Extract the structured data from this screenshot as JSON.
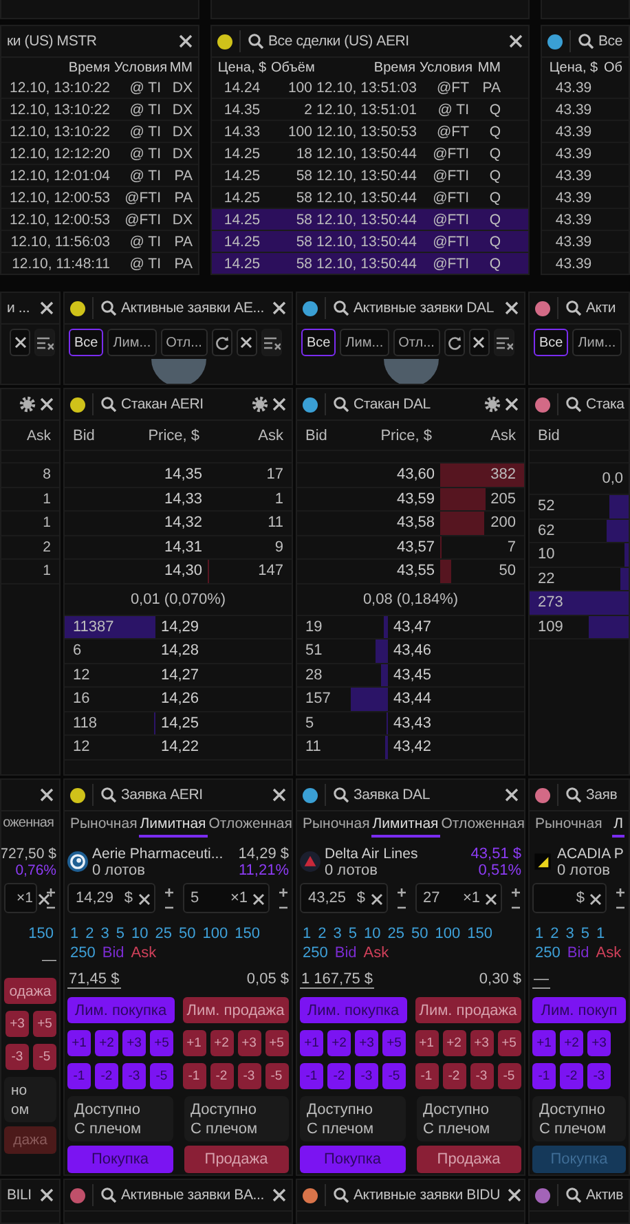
{
  "trades": [
    {
      "title": "ки (US) MSTR",
      "columns": [
        "Время",
        "Условия",
        "MM"
      ],
      "rows": [
        {
          "cells": [
            "12.10, 13:10:22",
            "@ TI",
            "DX"
          ],
          "selected": false
        },
        {
          "cells": [
            "12.10, 13:10:22",
            "@ TI",
            "DX"
          ],
          "selected": false
        },
        {
          "cells": [
            "12.10, 13:10:22",
            "@ TI",
            "DX"
          ],
          "selected": false
        },
        {
          "cells": [
            "12.10, 12:12:20",
            "@ TI",
            "DX"
          ],
          "selected": false
        },
        {
          "cells": [
            "12.10, 12:01:04",
            "@ TI",
            "PA"
          ],
          "selected": false
        },
        {
          "cells": [
            "12.10, 12:00:53",
            "@FTI",
            "PA"
          ],
          "selected": false
        },
        {
          "cells": [
            "12.10, 12:00:53",
            "@FTI",
            "DX"
          ],
          "selected": false
        },
        {
          "cells": [
            "12.10, 11:56:03",
            "@ TI",
            "PA"
          ],
          "selected": false
        },
        {
          "cells": [
            "12.10, 11:48:11",
            "@ TI",
            "PA"
          ],
          "selected": false
        }
      ]
    },
    {
      "color": "#cfc21a",
      "title": "Все сделки (US) AERI",
      "columns": [
        "Цена, $",
        "Объём",
        "Время",
        "Условия",
        "MM"
      ],
      "rows": [
        {
          "cells": [
            "14.24",
            "100",
            "12.10, 13:51:03",
            "@FT",
            "PA"
          ],
          "selected": false
        },
        {
          "cells": [
            "14.35",
            "2",
            "12.10, 13:51:01",
            "@ TI",
            "Q"
          ],
          "selected": false
        },
        {
          "cells": [
            "14.33",
            "100",
            "12.10, 13:50:53",
            "@FT",
            "Q"
          ],
          "selected": false
        },
        {
          "cells": [
            "14.25",
            "18",
            "12.10, 13:50:44",
            "@FTI",
            "Q"
          ],
          "selected": false
        },
        {
          "cells": [
            "14.25",
            "58",
            "12.10, 13:50:44",
            "@FTI",
            "Q"
          ],
          "selected": false
        },
        {
          "cells": [
            "14.25",
            "58",
            "12.10, 13:50:44",
            "@FTI",
            "Q"
          ],
          "selected": false
        },
        {
          "cells": [
            "14.25",
            "58",
            "12.10, 13:50:44",
            "@FTI",
            "Q"
          ],
          "selected": true
        },
        {
          "cells": [
            "14.25",
            "58",
            "12.10, 13:50:44",
            "@FTI",
            "Q"
          ],
          "selected": true
        },
        {
          "cells": [
            "14.25",
            "58",
            "12.10, 13:50:44",
            "@FTI",
            "Q"
          ],
          "selected": true
        }
      ]
    },
    {
      "color": "#3a9fd4",
      "title": "Все",
      "columns": [
        "Цена, $",
        "Об"
      ],
      "rows": [
        {
          "cells": [
            "43.39"
          ],
          "selected": false
        },
        {
          "cells": [
            "43.39"
          ],
          "selected": false
        },
        {
          "cells": [
            "43.39"
          ],
          "selected": false
        },
        {
          "cells": [
            "43.39"
          ],
          "selected": false
        },
        {
          "cells": [
            "43.39"
          ],
          "selected": false
        },
        {
          "cells": [
            "43.39"
          ],
          "selected": false
        },
        {
          "cells": [
            "43.39"
          ],
          "selected": false
        },
        {
          "cells": [
            "43.39"
          ],
          "selected": false
        },
        {
          "cells": [
            "43.39"
          ],
          "selected": false
        }
      ]
    }
  ],
  "orders": [
    {
      "title": "и ...",
      "tools": [
        {
          "kind": "cancel"
        },
        {
          "kind": "clear"
        }
      ],
      "empty": false
    },
    {
      "color": "#cfc21a",
      "title": "Активные заявки AE...",
      "filters": [
        {
          "label": "Все",
          "selected": true
        },
        {
          "label": "Лим...",
          "selected": false
        },
        {
          "label": "Отл...",
          "selected": false
        }
      ],
      "tools": [
        {
          "kind": "refresh"
        },
        {
          "kind": "cancel"
        },
        {
          "kind": "clear"
        }
      ],
      "empty": true
    },
    {
      "color": "#3a9fd4",
      "title": "Активные заявки DAL",
      "filters": [
        {
          "label": "Все",
          "selected": true
        },
        {
          "label": "Лим...",
          "selected": false
        },
        {
          "label": "Отл...",
          "selected": false
        }
      ],
      "tools": [
        {
          "kind": "refresh"
        },
        {
          "kind": "cancel"
        },
        {
          "kind": "clear"
        }
      ],
      "empty": true
    },
    {
      "color": "#d36a86",
      "title": "Акти",
      "filters": [
        {
          "label": "Все",
          "selected": true
        },
        {
          "label": "Лим...",
          "selected": false
        }
      ],
      "empty": false
    }
  ],
  "books": [
    {
      "columns": [
        "Ask"
      ],
      "asks": [
        {
          "ask": "8"
        },
        {
          "ask": "1"
        },
        {
          "ask": "1"
        },
        {
          "ask": "2"
        },
        {
          "ask": "1"
        }
      ]
    },
    {
      "color": "#cfc21a",
      "title": "Стакан AERI",
      "columns": [
        "Bid",
        "Price, $",
        "Ask"
      ],
      "asks": [
        {
          "price": "14,35",
          "ask": "17"
        },
        {
          "price": "14,33",
          "ask": "1"
        },
        {
          "price": "14,32",
          "ask": "11"
        },
        {
          "price": "14,31",
          "ask": "9"
        },
        {
          "price": "14,30",
          "ask": "147"
        }
      ],
      "spread": "0,01 (0,070%)",
      "bids": [
        {
          "bid": "11387",
          "price": "14,29"
        },
        {
          "bid": "6",
          "price": "14,28"
        },
        {
          "bid": "12",
          "price": "14,27"
        },
        {
          "bid": "16",
          "price": "14,26"
        },
        {
          "bid": "118",
          "price": "14,25"
        },
        {
          "bid": "12",
          "price": "14,22"
        }
      ]
    },
    {
      "color": "#3a9fd4",
      "title": "Стакан DAL",
      "columns": [
        "Bid",
        "Price, $",
        "Ask"
      ],
      "asks": [
        {
          "price": "43,60",
          "ask": "382"
        },
        {
          "price": "43,59",
          "ask": "205"
        },
        {
          "price": "43,58",
          "ask": "200"
        },
        {
          "price": "43,57",
          "ask": "7"
        },
        {
          "price": "43,55",
          "ask": "50"
        }
      ],
      "spread": "0,08 (0,184%)",
      "bids": [
        {
          "bid": "19",
          "price": "43,47"
        },
        {
          "bid": "51",
          "price": "43,46"
        },
        {
          "bid": "28",
          "price": "43,45"
        },
        {
          "bid": "157",
          "price": "43,44"
        },
        {
          "bid": "5",
          "price": "43,43"
        },
        {
          "bid": "11",
          "price": "43,42"
        }
      ]
    },
    {
      "color": "#d36a86",
      "title": "Стака",
      "columns": [
        "Bid"
      ],
      "spread": "0,0",
      "bids": [
        {
          "bid": "52"
        },
        {
          "bid": "62"
        },
        {
          "bid": "10"
        },
        {
          "bid": "22"
        },
        {
          "bid": "273"
        },
        {
          "bid": "109"
        }
      ]
    }
  ],
  "forms": [
    {
      "tabs": [
        {
          "label": "оженная",
          "selected": false
        }
      ],
      "price": "727,50 $",
      "change": "0,76%",
      "price_highlighted": false,
      "qty_field": {
        "unit": "×1"
      },
      "quick": [
        [
          "150"
        ]
      ],
      "fee": "—",
      "limits": {
        "sell": "одажа"
      },
      "step_rows": [
        {
          "sell": [
            "+3",
            "+5"
          ]
        },
        {
          "sell": [
            "-3",
            "-5"
          ]
        }
      ],
      "cards": [
        [
          "но",
          "ом"
        ]
      ],
      "sell": {
        "label": "дажа",
        "disabled": true
      }
    },
    {
      "color": "#cfc21a",
      "title": "Заявка AERI",
      "tabs": [
        {
          "label": "Рыночная",
          "selected": false
        },
        {
          "label": "Лимитная",
          "selected": true
        },
        {
          "label": "Отложенная",
          "selected": false
        }
      ],
      "name": "Aerie Pharmaceuti...",
      "lots": "0 лотов",
      "price": "14,29 $",
      "change": "11,21%",
      "price_highlighted": false,
      "price_field": {
        "value": "14,29",
        "unit": "$"
      },
      "qty_field": {
        "value": "5",
        "unit": "×1"
      },
      "quick": [
        [
          "1",
          "2",
          "3",
          "5",
          "10",
          "25",
          "50",
          "100",
          "150"
        ],
        [
          "250"
        ]
      ],
      "bid": "Bid",
      "ask": "Ask",
      "total": "71,45 $",
      "fee": "0,05 $",
      "limits": {
        "buy": "Лим. покупка",
        "sell": "Лим. продажа"
      },
      "step_rows": [
        {
          "buy": [
            "+1",
            "+2",
            "+3",
            "+5"
          ],
          "sell": [
            "+1",
            "+2",
            "+3",
            "+5"
          ]
        },
        {
          "buy": [
            "-1",
            "-2",
            "-3",
            "-5"
          ],
          "sell": [
            "-1",
            "-2",
            "-3",
            "-5"
          ]
        }
      ],
      "cards": [
        [
          "Доступно",
          "С плечом"
        ],
        [
          "Доступно",
          "С плечом"
        ]
      ],
      "buy": {
        "label": "Покупка",
        "disabled": false
      },
      "sell": {
        "label": "Продажа",
        "disabled": false
      }
    },
    {
      "color": "#3a9fd4",
      "title": "Заявка DAL",
      "tabs": [
        {
          "label": "Рыночная",
          "selected": false
        },
        {
          "label": "Лимитная",
          "selected": true
        },
        {
          "label": "Отложенная",
          "selected": false
        }
      ],
      "name": "Delta Air Lines",
      "lots": "0 лотов",
      "price": "43,51 $",
      "change": "0,51%",
      "price_highlighted": true,
      "price_field": {
        "value": "43,25",
        "unit": "$"
      },
      "qty_field": {
        "value": "27",
        "unit": "×1"
      },
      "quick": [
        [
          "1",
          "2",
          "3",
          "5",
          "10",
          "25",
          "50",
          "100",
          "150"
        ],
        [
          "250"
        ]
      ],
      "bid": "Bid",
      "ask": "Ask",
      "total": "1 167,75 $",
      "fee": "0,30 $",
      "limits": {
        "buy": "Лим. покупка",
        "sell": "Лим. продажа"
      },
      "step_rows": [
        {
          "buy": [
            "+1",
            "+2",
            "+3",
            "+5"
          ],
          "sell": [
            "+1",
            "+2",
            "+3",
            "+5"
          ]
        },
        {
          "buy": [
            "-1",
            "-2",
            "-3",
            "-5"
          ],
          "sell": [
            "-1",
            "-2",
            "-3",
            "-5"
          ]
        }
      ],
      "cards": [
        [
          "Доступно",
          "С плечом"
        ],
        [
          "Доступно",
          "С плечом"
        ]
      ],
      "buy": {
        "label": "Покупка",
        "disabled": false
      },
      "sell": {
        "label": "Продажа",
        "disabled": false
      }
    },
    {
      "color": "#d36a86",
      "title": "Заяв",
      "tabs": [
        {
          "label": "Рыночная",
          "selected": false
        },
        {
          "label": "Л",
          "selected": true
        }
      ],
      "name": "ACADIA P",
      "lots": "0 лотов",
      "price_field": {
        "unit": "$"
      },
      "quick": [
        [
          "1",
          "2",
          "3",
          "5",
          "1"
        ],
        [
          "250"
        ]
      ],
      "bid": "Bid",
      "ask": "Ask",
      "total": "—",
      "limits": {
        "buy": "Лим. покуп"
      },
      "step_rows": [
        {
          "buy": [
            "+1",
            "+2",
            "+3"
          ]
        },
        {
          "buy": [
            "-1",
            "-2",
            "-3"
          ]
        }
      ],
      "cards": [
        [
          "Доступно",
          "С плечом"
        ]
      ],
      "buy": {
        "label": "Покупка",
        "disabled": true
      }
    }
  ],
  "bottom": [
    {
      "title": "BILI"
    },
    {
      "color": "#c0506a",
      "title": "Активные заявки BA..."
    },
    {
      "color": "#d9744a",
      "title": "Активные заявки BIDU"
    },
    {
      "color": "#a364b8",
      "title": "Актив"
    }
  ]
}
